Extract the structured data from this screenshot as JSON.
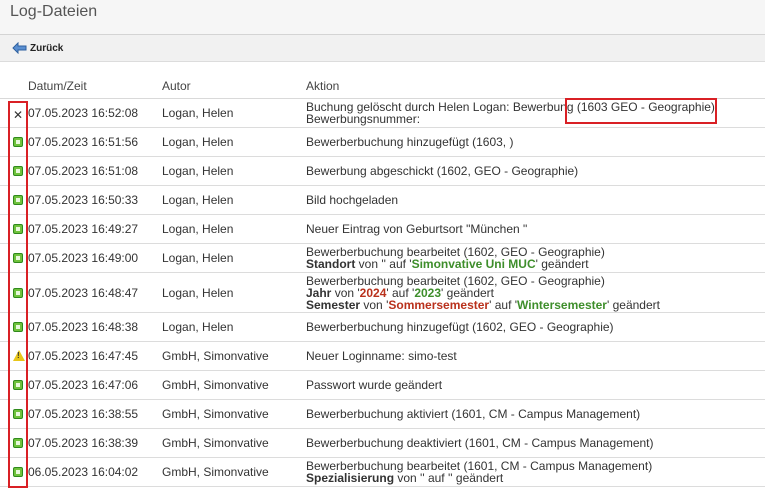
{
  "header": {
    "title": "Log-Dateien"
  },
  "toolbar": {
    "back_label": "Zurück"
  },
  "table": {
    "columns": [
      "Datum/Zeit",
      "Autor",
      "Aktion"
    ],
    "rows": [
      {
        "status": "error",
        "datetime": "07.05.2023 16:52:08",
        "author": "Logan, Helen",
        "lines": [
          [
            {
              "t": "Buchung gelöscht durch Helen Logan: Bewerbung (1603 GEO - Geographie)"
            }
          ],
          [
            {
              "t": "Bewerbungsnummer:"
            }
          ]
        ]
      },
      {
        "status": "ok",
        "datetime": "07.05.2023 16:51:56",
        "author": "Logan, Helen",
        "lines": [
          [
            {
              "t": "Bewerberbuchung hinzugefügt (1603, )"
            }
          ]
        ]
      },
      {
        "status": "ok",
        "datetime": "07.05.2023 16:51:08",
        "author": "Logan, Helen",
        "lines": [
          [
            {
              "t": "Bewerbung abgeschickt (1602, GEO - Geographie)"
            }
          ]
        ]
      },
      {
        "status": "ok",
        "datetime": "07.05.2023 16:50:33",
        "author": "Logan, Helen",
        "lines": [
          [
            {
              "t": "Bild hochgeladen"
            }
          ]
        ]
      },
      {
        "status": "ok",
        "datetime": "07.05.2023 16:49:27",
        "author": "Logan, Helen",
        "lines": [
          [
            {
              "t": "Neuer Eintrag von Geburtsort \"München \""
            }
          ]
        ]
      },
      {
        "status": "ok",
        "datetime": "07.05.2023 16:49:00",
        "author": "Logan, Helen",
        "lines": [
          [
            {
              "t": "Bewerberbuchung bearbeitet (1602, GEO - Geographie)"
            }
          ],
          [
            {
              "t": "Standort",
              "s": "b"
            },
            {
              "t": " von '' auf '"
            },
            {
              "t": "Simonvative Uni MUC",
              "s": "g"
            },
            {
              "t": "' geändert"
            }
          ]
        ]
      },
      {
        "status": "ok",
        "datetime": "07.05.2023 16:48:47",
        "author": "Logan, Helen",
        "lines": [
          [
            {
              "t": "Bewerberbuchung bearbeitet (1602, GEO - Geographie)"
            }
          ],
          [
            {
              "t": "Jahr",
              "s": "b"
            },
            {
              "t": " von '"
            },
            {
              "t": "2024",
              "s": "r"
            },
            {
              "t": "' auf '"
            },
            {
              "t": "2023",
              "s": "g"
            },
            {
              "t": "' geändert"
            }
          ],
          [
            {
              "t": "Semester",
              "s": "b"
            },
            {
              "t": " von '"
            },
            {
              "t": "Sommersemester",
              "s": "r"
            },
            {
              "t": "' auf '"
            },
            {
              "t": "Wintersemester",
              "s": "g"
            },
            {
              "t": "' geändert"
            }
          ]
        ]
      },
      {
        "status": "ok",
        "datetime": "07.05.2023 16:48:38",
        "author": "Logan, Helen",
        "lines": [
          [
            {
              "t": "Bewerberbuchung hinzugefügt (1602, GEO - Geographie)"
            }
          ]
        ]
      },
      {
        "status": "warn",
        "datetime": "07.05.2023 16:47:45",
        "author": "GmbH, Simonvative",
        "lines": [
          [
            {
              "t": "Neuer Loginname: simo-test"
            }
          ]
        ]
      },
      {
        "status": "ok",
        "datetime": "07.05.2023 16:47:06",
        "author": "GmbH, Simonvative",
        "lines": [
          [
            {
              "t": "Passwort wurde geändert"
            }
          ]
        ]
      },
      {
        "status": "ok",
        "datetime": "07.05.2023 16:38:55",
        "author": "GmbH, Simonvative",
        "lines": [
          [
            {
              "t": "Bewerberbuchung aktiviert (1601, CM - Campus Management)"
            }
          ]
        ]
      },
      {
        "status": "ok",
        "datetime": "07.05.2023 16:38:39",
        "author": "GmbH, Simonvative",
        "lines": [
          [
            {
              "t": "Bewerberbuchung deaktiviert (1601, CM - Campus Management)"
            }
          ]
        ]
      },
      {
        "status": "ok",
        "datetime": "06.05.2023 16:04:02",
        "author": "GmbH, Simonvative",
        "lines": [
          [
            {
              "t": "Bewerberbuchung bearbeitet (1601, CM - Campus Management)"
            }
          ],
          [
            {
              "t": "Spezialisierung",
              "s": "b"
            },
            {
              "t": " von '' auf '' geändert"
            }
          ]
        ]
      }
    ]
  },
  "colors": {
    "highlight": "#d92025",
    "status_ok": "#6fc23c",
    "status_error": "#e0332a",
    "status_warn": "#e8c619",
    "changed_new": "#3e8e2b",
    "changed_old": "#b9311c"
  }
}
